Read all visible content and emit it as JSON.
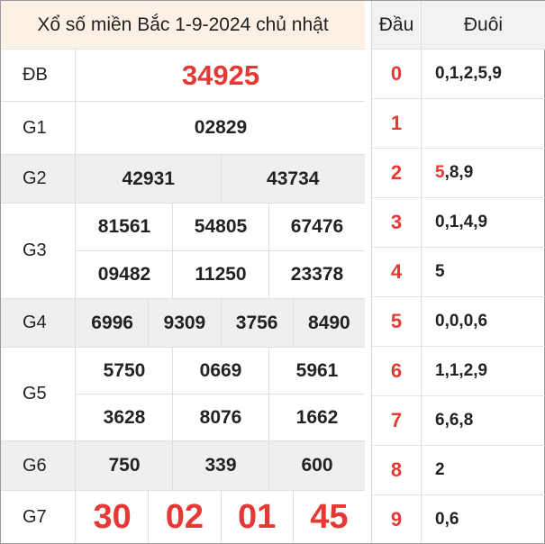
{
  "title": "Xổ số miền Bắc 1-9-2024 chủ nhật",
  "prizes": {
    "db": {
      "label": "ĐB",
      "numbers": [
        "34925"
      ]
    },
    "g1": {
      "label": "G1",
      "numbers": [
        "02829"
      ]
    },
    "g2": {
      "label": "G2",
      "numbers": [
        "42931",
        "43734"
      ]
    },
    "g3": {
      "label": "G3",
      "numbers": [
        "81561",
        "54805",
        "67476",
        "09482",
        "11250",
        "23378"
      ]
    },
    "g4": {
      "label": "G4",
      "numbers": [
        "6996",
        "9309",
        "3756",
        "8490"
      ]
    },
    "g5": {
      "label": "G5",
      "numbers": [
        "5750",
        "0669",
        "5961",
        "3628",
        "8076",
        "1662"
      ]
    },
    "g6": {
      "label": "G6",
      "numbers": [
        "750",
        "339",
        "600"
      ]
    },
    "g7": {
      "label": "G7",
      "numbers": [
        "30",
        "02",
        "01",
        "45"
      ]
    }
  },
  "loto": {
    "head_label": "Đầu",
    "tail_label": "Đuôi",
    "rows": [
      {
        "head": "0",
        "tail_highlight": "",
        "tail": "0,1,2,5,9"
      },
      {
        "head": "1",
        "tail_highlight": "",
        "tail": ""
      },
      {
        "head": "2",
        "tail_highlight": "5",
        "tail": ",8,9"
      },
      {
        "head": "3",
        "tail_highlight": "",
        "tail": "0,1,4,9"
      },
      {
        "head": "4",
        "tail_highlight": "",
        "tail": "5"
      },
      {
        "head": "5",
        "tail_highlight": "",
        "tail": "0,0,0,6"
      },
      {
        "head": "6",
        "tail_highlight": "",
        "tail": "1,1,2,9"
      },
      {
        "head": "7",
        "tail_highlight": "",
        "tail": "6,6,8"
      },
      {
        "head": "8",
        "tail_highlight": "",
        "tail": "2"
      },
      {
        "head": "9",
        "tail_highlight": "",
        "tail": "0,6"
      }
    ]
  },
  "colors": {
    "accent_red": "#e53935",
    "title_bg": "#fdf1e6",
    "shade": "#efefef"
  }
}
